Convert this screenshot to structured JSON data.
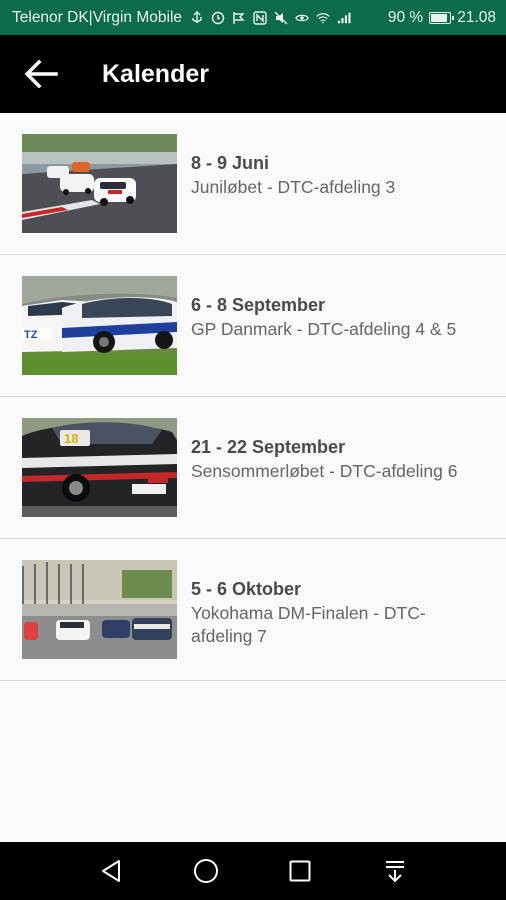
{
  "status_bar": {
    "carrier": "Telenor DK|Virgin Mobile",
    "battery_percent": "90 %",
    "battery_level": 0.9,
    "time": "21.08",
    "icons": [
      "usb-icon",
      "alarm-icon",
      "data-saver-icon",
      "nfc-icon",
      "mute-icon",
      "eye-comfort-icon",
      "wifi-icon",
      "signal-icon",
      "battery-icon"
    ]
  },
  "app_bar": {
    "title": "Kalender",
    "back_icon": "arrow-left-icon"
  },
  "events": [
    {
      "date": "8 - 9 Juni",
      "title": "Juniløbet - DTC-afdeling 3"
    },
    {
      "date": "6 - 8 September",
      "title": "GP Danmark - DTC-afdeling 4 & 5"
    },
    {
      "date": "21 - 22 September",
      "title": "Sensommerløbet - DTC-afdeling 6"
    },
    {
      "date": "5 - 6 Oktober",
      "title": "Yokohama DM-Finalen - DTC-afdeling 7"
    }
  ],
  "thumb_text": {
    "car_number": "18",
    "car_sponsor": "TZ"
  },
  "nav_bar": {
    "buttons": [
      "back-triangle-icon",
      "home-circle-icon",
      "recents-square-icon",
      "notification-pulldown-icon"
    ]
  },
  "colors": {
    "status_bar": "#0b6b4a",
    "app_bar": "#000000",
    "background": "#fafafa",
    "divider": "#dadada"
  }
}
